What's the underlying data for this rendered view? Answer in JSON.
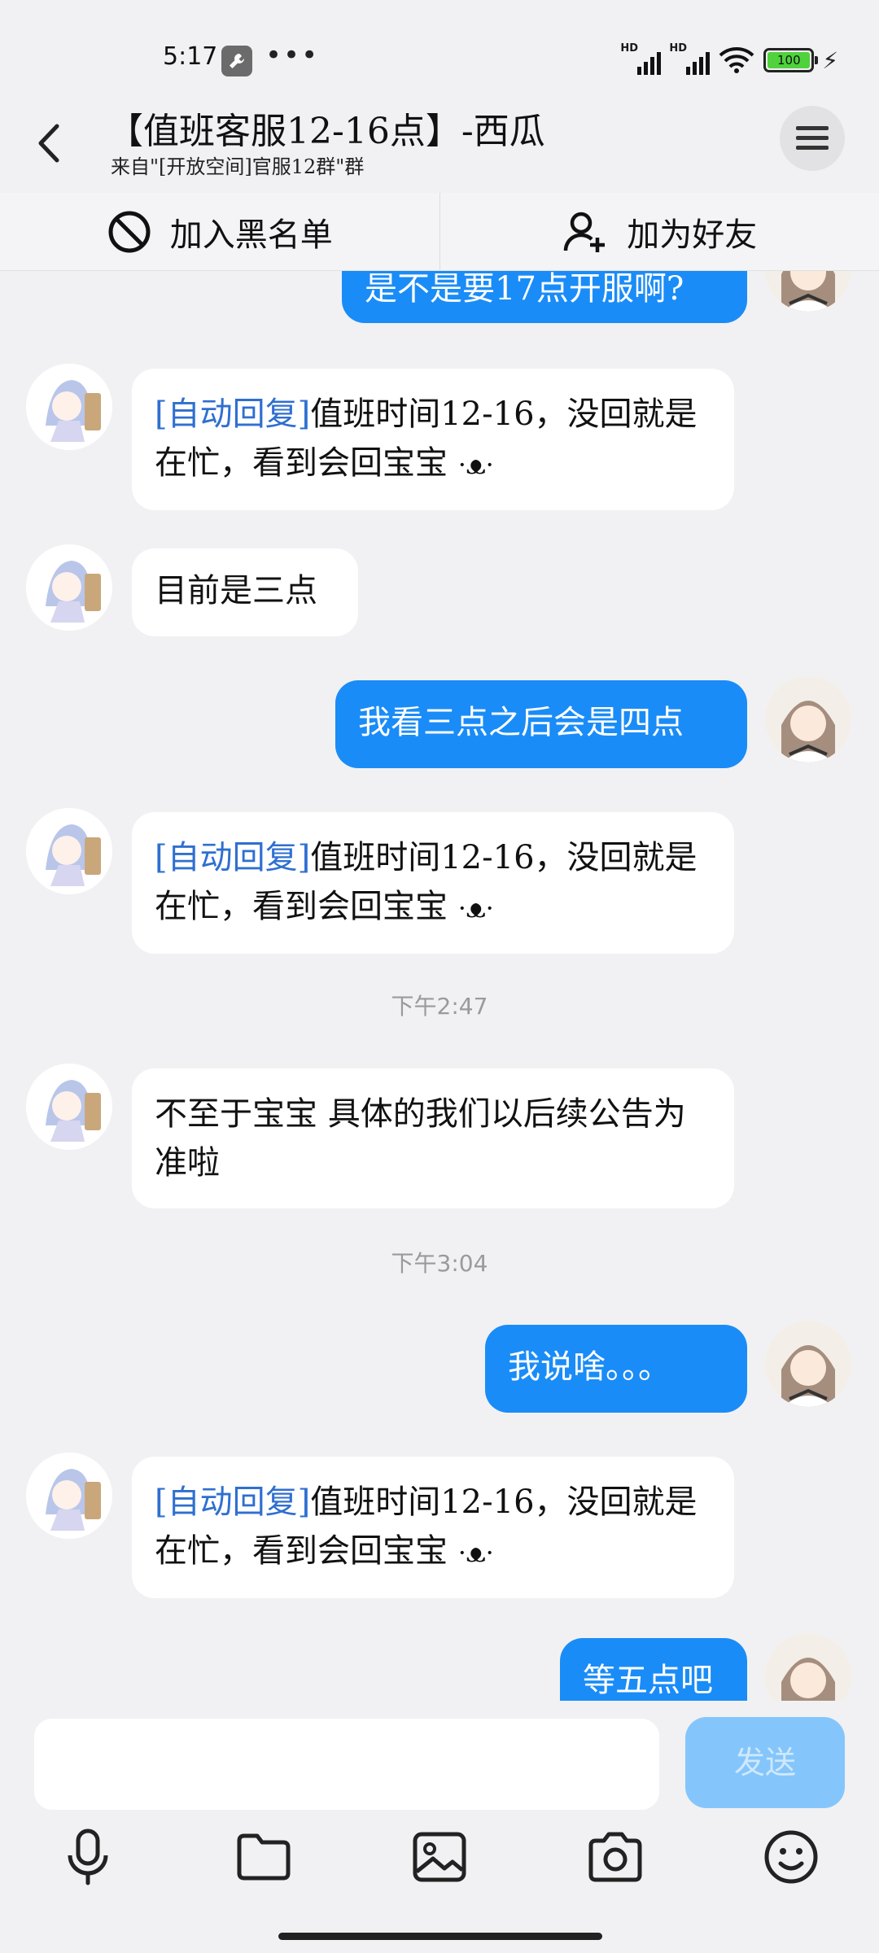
{
  "status": {
    "time": "5:17",
    "dots": "•••",
    "battery": "100",
    "hd": "HD"
  },
  "header": {
    "title": "【值班客服12-16点】-西瓜",
    "subtitle": "来自\"[开放空间]官服12群\"群"
  },
  "actions": {
    "blacklist": "加入黑名单",
    "add_friend": "加为好友"
  },
  "messages": {
    "m0": "是不是要17点开服啊?",
    "m1_tag": "[自动回复]",
    "m1_text": "值班时间12-16，没回就是在忙，看到会回宝宝",
    "m1_emoji": "·ᴥ·",
    "m2": "目前是三点",
    "m3": "我看三点之后会是四点",
    "m4_tag": "[自动回复]",
    "m4_text": "值班时间12-16，没回就是在忙，看到会回宝宝",
    "m4_emoji": "·ᴥ·",
    "ts1": "下午2:47",
    "m5": "不至于宝宝 具体的我们以后续公告为准啦",
    "ts2": "下午3:04",
    "m6": "我说啥。。。",
    "m7_tag": "[自动回复]",
    "m7_text": "值班时间12-16，没回就是在忙，看到会回宝宝",
    "m7_emoji": "·ᴥ·",
    "m8": "等五点吧"
  },
  "input": {
    "value": "",
    "send_label": "发送"
  },
  "colors": {
    "bubble_out": "#1a8cf7",
    "auto_tag": "#2f6fd0",
    "send_disabled": "#84c6fb"
  },
  "icons": {
    "back": "chevron-left-icon",
    "menu": "hamburger-menu-icon",
    "blacklist": "block-icon",
    "add_friend": "add-user-icon",
    "voice": "microphone-icon",
    "file": "folder-icon",
    "image": "image-icon",
    "camera": "camera-icon",
    "emoji": "smiley-icon"
  }
}
